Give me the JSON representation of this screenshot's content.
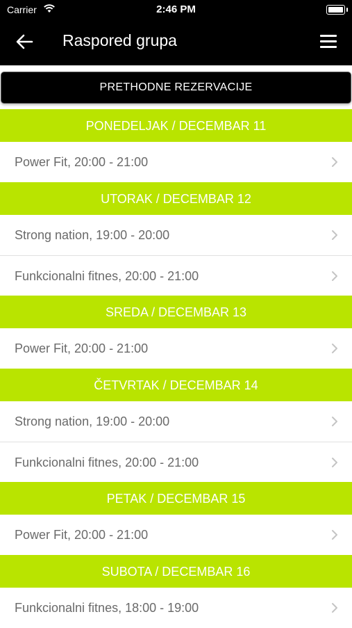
{
  "status_bar": {
    "carrier": "Carrier",
    "time": "2:46 PM"
  },
  "header": {
    "title": "Raspored grupa"
  },
  "previous_button": "PRETHODNE REZERVACIJE",
  "colors": {
    "accent": "#b9e400",
    "bar": "#000000"
  },
  "days": [
    {
      "label": "PONEDELJAK / DECEMBAR 11",
      "sessions": [
        "Power Fit, 20:00 - 21:00"
      ]
    },
    {
      "label": "UTORAK / DECEMBAR 12",
      "sessions": [
        "Strong nation, 19:00 - 20:00",
        "Funkcionalni fitnes, 20:00 - 21:00"
      ]
    },
    {
      "label": "SREDA / DECEMBAR 13",
      "sessions": [
        "Power Fit, 20:00 - 21:00"
      ]
    },
    {
      "label": "ČETVRTAK / DECEMBAR 14",
      "sessions": [
        "Strong nation, 19:00 - 20:00",
        "Funkcionalni fitnes, 20:00 - 21:00"
      ]
    },
    {
      "label": "PETAK / DECEMBAR 15",
      "sessions": [
        "Power Fit, 20:00 - 21:00"
      ]
    },
    {
      "label": "SUBOTA / DECEMBAR 16",
      "sessions": [
        "Funkcionalni fitnes, 18:00 - 19:00"
      ]
    }
  ]
}
